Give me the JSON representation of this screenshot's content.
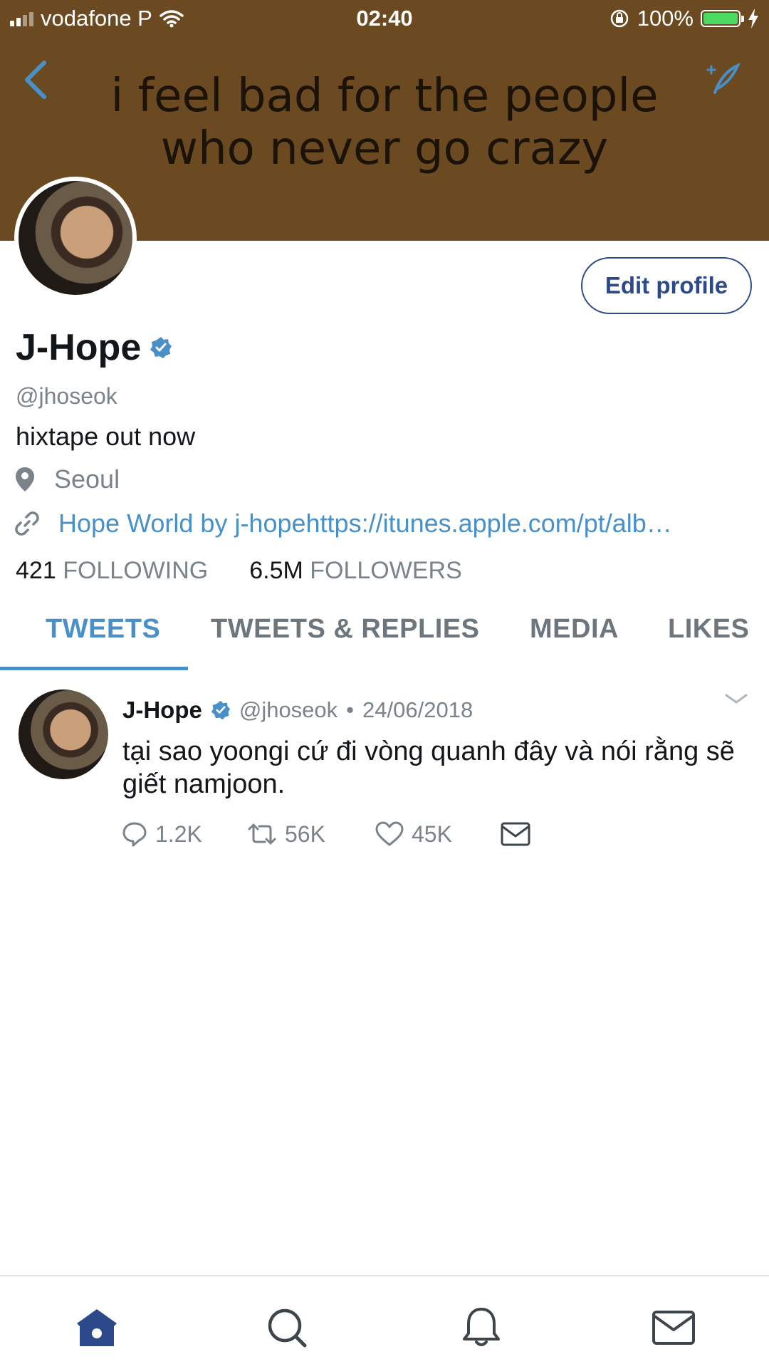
{
  "status_bar": {
    "carrier": "vodafone P",
    "time": "02:40",
    "battery": "100%",
    "battery_color": "#4cd964"
  },
  "header": {
    "banner_text_line1": "i feel bad for the people",
    "banner_text_line2": "who never go crazy",
    "banner_color": "#6b4a22",
    "back_icon": "chevron-left-icon",
    "compose_icon": "quill-compose-icon"
  },
  "profile": {
    "name": "J-Hope",
    "verified": true,
    "handle": "@jhoseok",
    "bio": "hixtape out now",
    "location": "Seoul",
    "link": "Hope World by j-hopehttps://itunes.apple.com/pt/alb…",
    "edit_profile_label": "Edit profile",
    "following_count": "421",
    "following_label": "FOLLOWING",
    "followers_count": "6.5M",
    "followers_label": "FOLLOWERS"
  },
  "tabs": [
    {
      "label": "TWEETS",
      "active": true
    },
    {
      "label": "TWEETS & REPLIES",
      "active": false
    },
    {
      "label": "MEDIA",
      "active": false
    },
    {
      "label": "LIKES",
      "active": false
    }
  ],
  "tweet": {
    "name": "J-Hope",
    "handle": "@jhoseok",
    "separator": "•",
    "date": "24/06/2018",
    "text": "tại sao yoongi cứ đi vòng quanh đây và nói rằng sẽ giết namjoon.",
    "replies": "1.2K",
    "retweets": "56K",
    "likes": "45K"
  },
  "bottom_nav": [
    {
      "icon": "home-icon",
      "active": true
    },
    {
      "icon": "search-icon",
      "active": false
    },
    {
      "icon": "bell-icon",
      "active": false
    },
    {
      "icon": "mail-icon",
      "active": false
    }
  ],
  "colors": {
    "accent": "#4a90c8",
    "nav_active": "#2c4a8a",
    "muted": "#7a8389"
  }
}
